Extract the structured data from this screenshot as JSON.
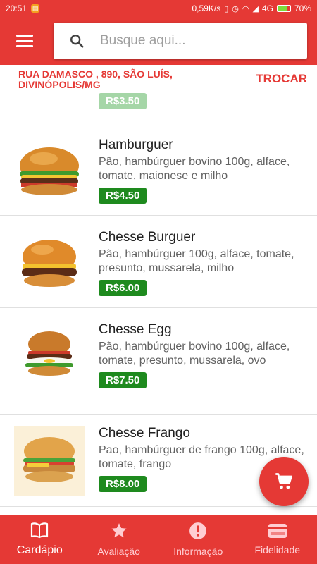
{
  "status_bar": {
    "time": "20:51",
    "net_speed": "0,59K/s",
    "network": "4G",
    "battery": "70%",
    "battery_level": 0.7
  },
  "search": {
    "placeholder": "Busque aqui..."
  },
  "address": {
    "text": "RUA DAMASCO , 890, SÃO LUÍS, DIVINÓPOLIS/MG",
    "change_label": "TROCAR"
  },
  "partial_item": {
    "price": "R$3.50"
  },
  "items": [
    {
      "name": "Hamburguer",
      "description": "Pão, hambúrguer bovino 100g, alface, tomate, maionese e milho",
      "price": "R$4.50"
    },
    {
      "name": "Chesse Burguer",
      "description": "Pão, hambúrguer 100g, alface, tomate, presunto, mussarela, milho",
      "price": "R$6.00"
    },
    {
      "name": "Chesse Egg",
      "description": "Pão, hambúrguer bovino 100g, alface, tomate, presunto, mussarela, ovo",
      "price": "R$7.50"
    },
    {
      "name": "Chesse Frango",
      "description": "Pao, hambúrguer de frango 100g, alface, tomate, frango",
      "price": "R$8.00"
    }
  ],
  "bottom_nav": [
    {
      "label": "Cardápio",
      "icon": "book-icon",
      "active": true
    },
    {
      "label": "Avaliação",
      "icon": "star-icon",
      "active": false
    },
    {
      "label": "Informação",
      "icon": "alert-circle-icon",
      "active": false
    },
    {
      "label": "Fidelidade",
      "icon": "credit-card-icon",
      "active": false
    }
  ],
  "colors": {
    "primary": "#e53935",
    "price": "#1e8a1e"
  }
}
